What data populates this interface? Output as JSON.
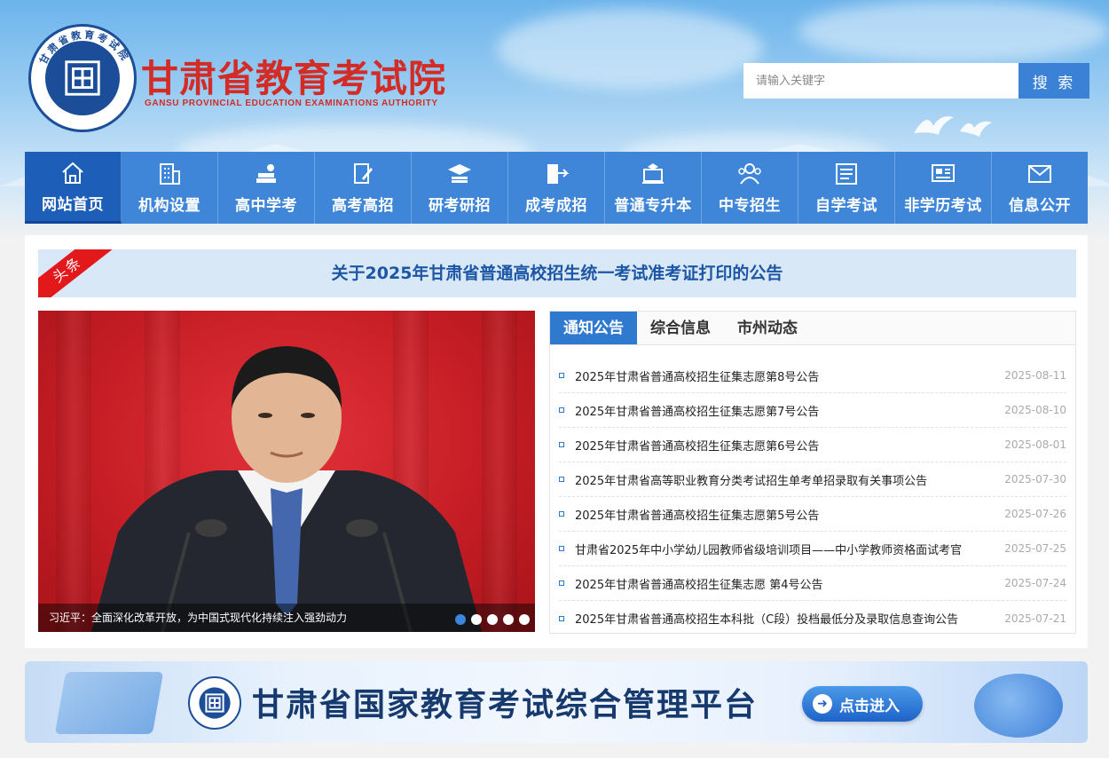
{
  "header": {
    "site_name": "甘肃省教育考试院",
    "site_name_en": "GANSU PROVINCIAL EDUCATION EXAMINATIONS AUTHORITY",
    "logo_ring_text": "甘肃省教育考试院"
  },
  "search": {
    "placeholder": "请输入关键字",
    "button_label": "搜 索"
  },
  "nav": {
    "items": [
      {
        "label": "网站首页",
        "icon": "home-icon"
      },
      {
        "label": "机构设置",
        "icon": "building-icon"
      },
      {
        "label": "高中学考",
        "icon": "books-icon"
      },
      {
        "label": "高考高招",
        "icon": "pencil-paper-icon"
      },
      {
        "label": "研考研招",
        "icon": "graduation-cap-icon"
      },
      {
        "label": "成考成招",
        "icon": "book-arrow-icon"
      },
      {
        "label": "普通专升本",
        "icon": "laptop-cap-icon"
      },
      {
        "label": "中专招生",
        "icon": "people-icon"
      },
      {
        "label": "自学考试",
        "icon": "document-icon"
      },
      {
        "label": "非学历考试",
        "icon": "id-card-icon"
      },
      {
        "label": "信息公开",
        "icon": "mail-icon"
      }
    ]
  },
  "headline": {
    "tag": "头条",
    "title": "关于2025年甘肃省普通高校招生统一考试准考证打印的公告"
  },
  "carousel": {
    "caption": "习近平：全面深化改革开放，为中国式现代化持续注入强劲动力",
    "slide_count": 5,
    "active_slide": 1
  },
  "news": {
    "tabs": [
      {
        "label": "通知公告"
      },
      {
        "label": "综合信息"
      },
      {
        "label": "市州动态"
      }
    ],
    "items": [
      {
        "title": "2025年甘肃省普通高校招生征集志愿第8号公告",
        "date": "2025-08-11"
      },
      {
        "title": "2025年甘肃省普通高校招生征集志愿第7号公告",
        "date": "2025-08-10"
      },
      {
        "title": "2025年甘肃省普通高校招生征集志愿第6号公告",
        "date": "2025-08-01"
      },
      {
        "title": "2025年甘肃省高等职业教育分类考试招生单考单招录取有关事项公告",
        "date": "2025-07-30"
      },
      {
        "title": "2025年甘肃省普通高校招生征集志愿第5号公告",
        "date": "2025-07-26"
      },
      {
        "title": "甘肃省2025年中小学幼儿园教师省级培训项目——中小学教师资格面试考官",
        "date": "2025-07-25"
      },
      {
        "title": "2025年甘肃省普通高校招生征集志愿 第4号公告",
        "date": "2025-07-24"
      },
      {
        "title": "2025年甘肃省普通高校招生本科批（C段）投档最低分及录取信息查询公告",
        "date": "2025-07-21"
      }
    ]
  },
  "banner": {
    "title": "甘肃省国家教育考试综合管理平台",
    "button_label": "点击进入"
  },
  "colors": {
    "brand_red": "#d32b25",
    "nav_blue": "#3f86d8",
    "nav_active": "#1d5fb8",
    "tab_active": "#2f79cf",
    "headline_text": "#1c56a4"
  }
}
